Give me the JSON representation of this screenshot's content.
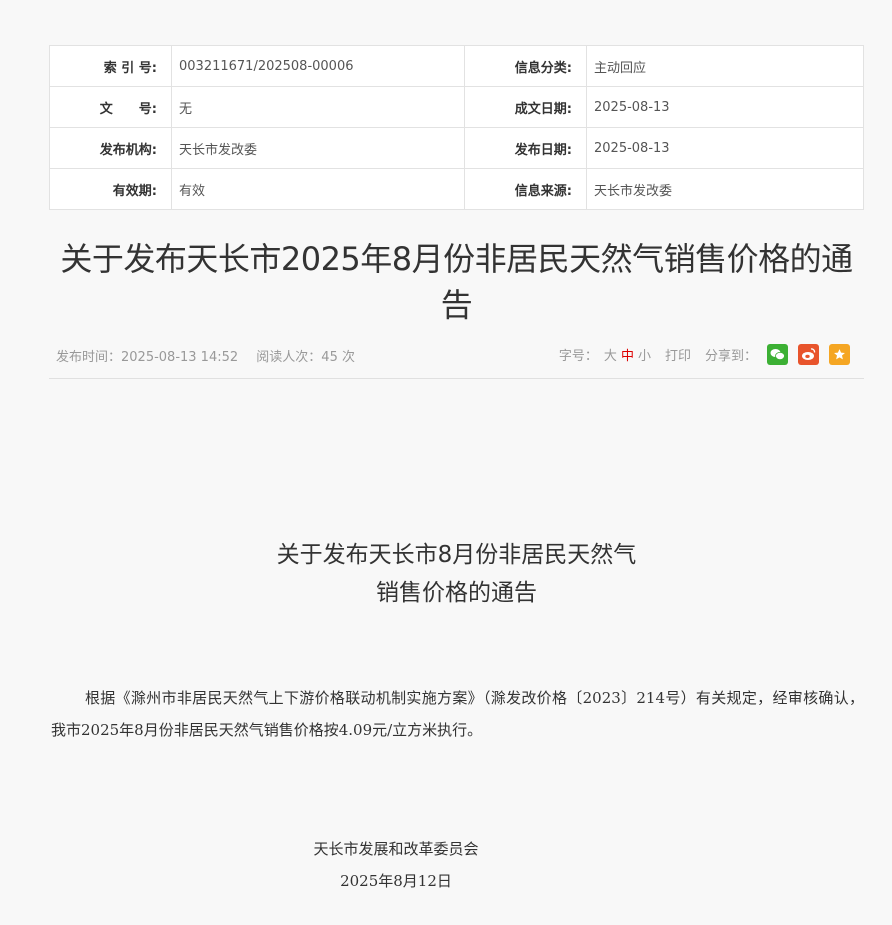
{
  "meta": {
    "r1": {
      "l1": "索 引 号:",
      "v1": "003211671/202508-00006",
      "l2": "信息分类:",
      "v2": "主动回应"
    },
    "r2": {
      "l1": "文　　号:",
      "v1": "无",
      "l2": "成文日期:",
      "v2": "2025-08-13"
    },
    "r3": {
      "l1": "发布机构:",
      "v1": "天长市发改委",
      "l2": "发布日期:",
      "v2": "2025-08-13"
    },
    "r4": {
      "l1": "有效期:",
      "v1": "有效",
      "l2": "信息来源:",
      "v2": "天长市发改委"
    }
  },
  "title": "关于发布天长市2025年8月份非居民天然气销售价格的通告",
  "info": {
    "publish_time": "发布时间：2025-08-13 14:52",
    "reads": "阅读人次：45 次",
    "font_label": "字号：",
    "size_large": "大",
    "size_medium": "中",
    "size_small": "小",
    "print": "打印",
    "share_label": "分享到："
  },
  "body": {
    "subtitle_line1": "关于发布天长市8月份非居民天然气",
    "subtitle_line2": "销售价格的通告",
    "paragraph": "根据《滁州市非居民天然气上下游价格联动机制实施方案》（滁发改价格〔2023〕214号）有关规定，经审核确认，我市2025年8月份非居民天然气销售价格按4.09元/立方米执行。",
    "signature": "天长市发展和改革委员会",
    "date": "2025年8月12日"
  },
  "icons": {
    "wechat": "wechat-icon",
    "weibo": "weibo-icon",
    "favorite": "star-icon"
  },
  "colors": {
    "wechat": "#3cb034",
    "weibo": "#e8542c",
    "favorite": "#f5a623",
    "active_size": "#dd0000"
  }
}
